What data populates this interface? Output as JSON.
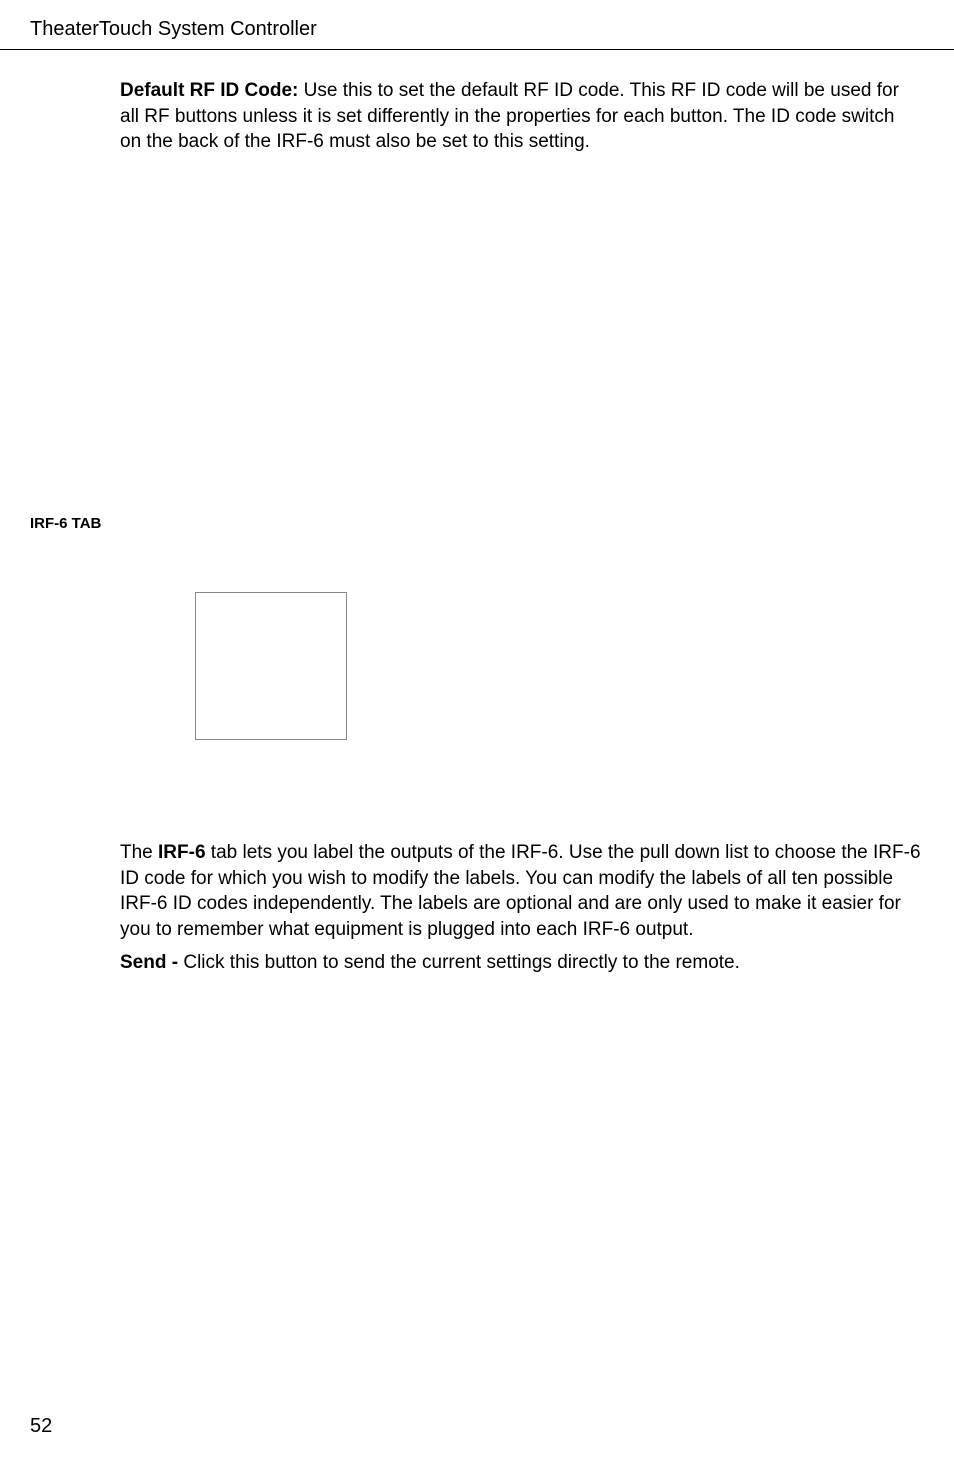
{
  "header": {
    "title": "TheaterTouch System Controller"
  },
  "para1": {
    "boldLabel": "Default RF ID Code:",
    "text": " Use this to set the default RF ID code.  This RF ID code will be used for all RF buttons unless it is set differently in the properties for each button.  The ID code switch on the back of the IRF-6 must also be set to this setting."
  },
  "sectionHeading": "IRF-6 TAB",
  "para2": {
    "prefix": "The ",
    "bold": "IRF-6",
    "text": " tab lets you label the outputs of the IRF-6. Use the pull down list to choose the IRF-6 ID code for which you wish to modify the labels. You can modify the labels of all ten possible IRF-6 ID codes independently. The labels are optional and are only used to make it easier for you to remember what equipment is plugged into each IRF-6 output."
  },
  "para3": {
    "bold": "Send - ",
    "text": "Click this button to send the current settings directly to the remote."
  },
  "pageNumber": "52"
}
